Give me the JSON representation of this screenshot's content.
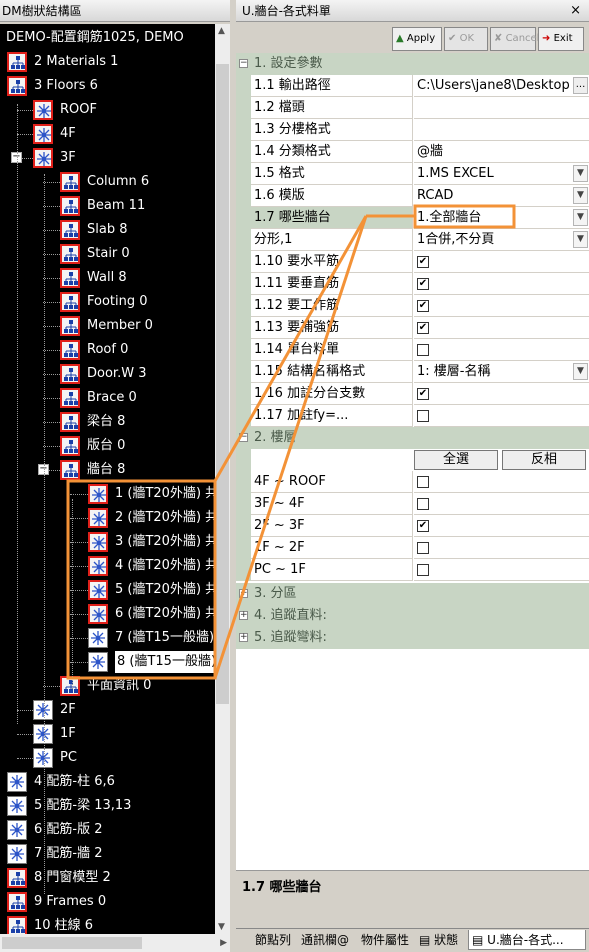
{
  "left_panel": {
    "title": "DM樹狀結構區"
  },
  "right_panel": {
    "title": "U.牆台-各式料單",
    "close": "×"
  },
  "tree": {
    "root": "DEMO-配置鋼筋1025, DEMO",
    "items": [
      {
        "label": "2 Materials 1"
      },
      {
        "label": "3 Floors 6"
      },
      {
        "label": "ROOF"
      },
      {
        "label": "4F"
      },
      {
        "label": "3F"
      },
      {
        "label": "Column 6"
      },
      {
        "label": "Beam 11"
      },
      {
        "label": "Slab 8"
      },
      {
        "label": "Stair 0"
      },
      {
        "label": "Wall 8"
      },
      {
        "label": "Footing 0"
      },
      {
        "label": "Member 0"
      },
      {
        "label": "Roof 0"
      },
      {
        "label": "Door.W 3"
      },
      {
        "label": "Brace 0"
      },
      {
        "label": "梁台 8"
      },
      {
        "label": "版台 0"
      },
      {
        "label": "牆台 8"
      },
      {
        "label": "1 (牆T20外牆) 共"
      },
      {
        "label": "2 (牆T20外牆) 共"
      },
      {
        "label": "3 (牆T20外牆) 共"
      },
      {
        "label": "4 (牆T20外牆) 共"
      },
      {
        "label": "5 (牆T20外牆) 共"
      },
      {
        "label": "6 (牆T20外牆) 共"
      },
      {
        "label": "7 (牆T15一般牆)"
      },
      {
        "label": "8 (牆T15一般牆)"
      },
      {
        "label": "平面資訊 0"
      },
      {
        "label": "2F"
      },
      {
        "label": "1F"
      },
      {
        "label": "PC"
      },
      {
        "label": "4 配筋-柱 6,6"
      },
      {
        "label": "5 配筋-梁 13,13"
      },
      {
        "label": "6 配筋-版 2"
      },
      {
        "label": "7 配筋-牆 2"
      },
      {
        "label": "8 門窗模型 2"
      },
      {
        "label": "9 Frames 0"
      },
      {
        "label": "10 柱線 6"
      }
    ]
  },
  "toolbar": {
    "apply": "Apply",
    "ok": "OK",
    "cancel": "Cancel",
    "exit": "Exit"
  },
  "grid": {
    "cat1": "1. 設定參數",
    "rows": [
      {
        "name": "1.1 輸出路徑",
        "value": "C:\\Users\\jane8\\Desktop"
      },
      {
        "name": "1.2 檔頭",
        "value": ""
      },
      {
        "name": "1.3 分樓格式",
        "value": ""
      },
      {
        "name": "1.4 分類格式",
        "value": "@牆"
      },
      {
        "name": "1.5 格式",
        "value": "1.MS EXCEL"
      },
      {
        "name": "1.6 模版",
        "value": "RCAD"
      },
      {
        "name": "1.7 哪些牆台",
        "value": "1.全部牆台"
      },
      {
        "name": "分形,1",
        "value": "1合併,不分頁"
      },
      {
        "name": "1.10 要水平筋",
        "value": "checked"
      },
      {
        "name": "1.11 要垂直筋",
        "value": "checked"
      },
      {
        "name": "1.12 要工作筋",
        "value": "checked"
      },
      {
        "name": "1.13 要補強筋",
        "value": "checked"
      },
      {
        "name": "1.14 單台料單",
        "value": "unchecked"
      },
      {
        "name": "1.15 結構名稱格式",
        "value": "1: 樓層-名稱"
      },
      {
        "name": "1.16 加註分台支數",
        "value": "checked"
      },
      {
        "name": "1.17 加註fy=...",
        "value": "unchecked"
      }
    ],
    "cat2": "2. 樓層",
    "select_all": "全選",
    "invert": "反相",
    "floors": [
      {
        "name": "4F ~ ROOF",
        "value": "unchecked"
      },
      {
        "name": "3F ~ 4F",
        "value": "unchecked"
      },
      {
        "name": "2F ~ 3F",
        "value": "checked"
      },
      {
        "name": "1F ~ 2F",
        "value": "unchecked"
      },
      {
        "name": "PC ~ 1F",
        "value": "unchecked"
      }
    ],
    "cat3": "3. 分區",
    "cat4": "4. 追蹤直料:",
    "cat5": "5. 追蹤彎料:"
  },
  "description": {
    "title": "1.7 哪些牆台"
  },
  "tabs": [
    {
      "label": "節點列"
    },
    {
      "label": "通訊欄@"
    },
    {
      "label": "物件屬性"
    },
    {
      "label": "狀態"
    },
    {
      "label": "U.牆台-各式..."
    }
  ],
  "colors": {
    "highlight": "#f39237",
    "category_bg": "#c8d5c4",
    "tree_bg": "#000000",
    "icon_border": "#e0201a"
  }
}
